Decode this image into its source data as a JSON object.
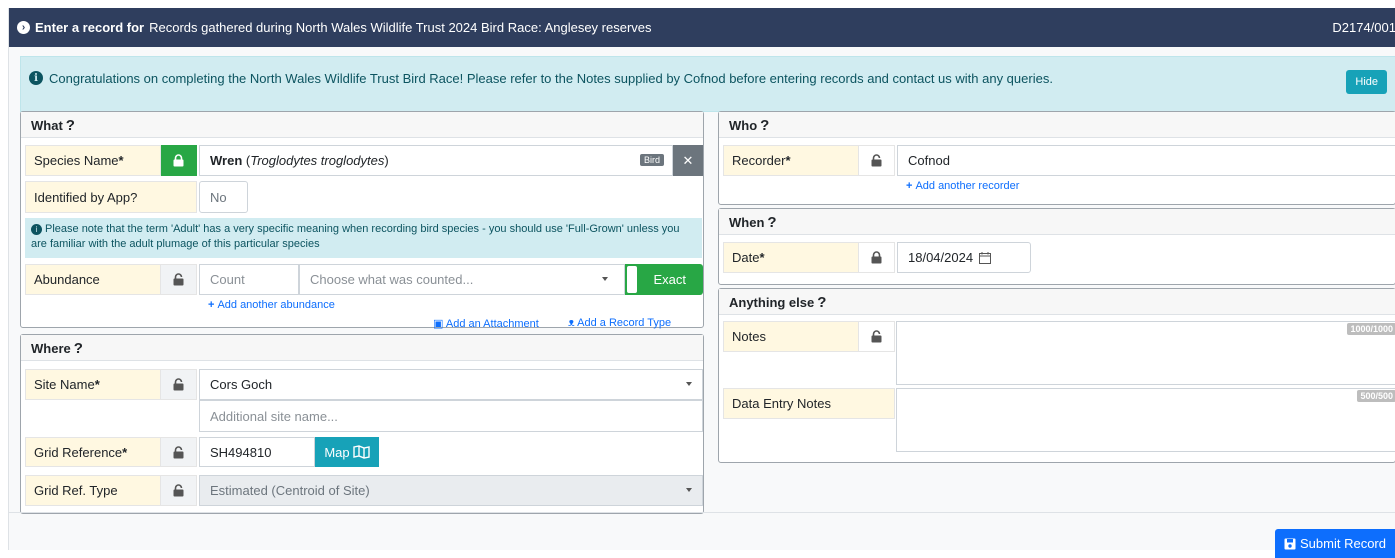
{
  "header": {
    "prefix": "Enter a record for",
    "title": "Records gathered during North Wales Wildlife Trust 2024 Bird Race: Anglesey reserves",
    "reference": "D2174/001"
  },
  "alert": {
    "message": "Congratulations on completing the North Wales Wildlife Trust Bird Race! Please refer to the Notes supplied by Cofnod before entering records and contact us with any queries.",
    "hide_label": "Hide"
  },
  "what": {
    "title": "What",
    "species_label": "Species Name",
    "species_common": "Wren",
    "species_latin": "Troglodytes troglodytes",
    "species_group": "Bird",
    "clear_symbol": "✕",
    "identified_label": "Identified by App?",
    "identified_value": "No",
    "note": "Please note that the term 'Adult' has a very specific meaning when recording bird species - you should use 'Full-Grown' unless you are familiar with the adult plumage of this particular species",
    "abundance_label": "Abundance",
    "count_placeholder": "Count",
    "counted_placeholder": "Choose what was counted...",
    "exact_label": "Exact",
    "add_abundance": "Add another abundance",
    "add_attachment": "Add an Attachment",
    "add_record_type": "Add a Record Type"
  },
  "where": {
    "title": "Where",
    "site_label": "Site Name",
    "site_value": "Cors Goch",
    "additional_placeholder": "Additional site name...",
    "grid_label": "Grid Reference",
    "grid_value": "SH494810",
    "map_label": "Map",
    "gridtype_label": "Grid Ref. Type",
    "gridtype_value": "Estimated (Centroid of Site)"
  },
  "who": {
    "title": "Who",
    "recorder_label": "Recorder",
    "recorder_value": "Cofnod",
    "add_recorder": "Add another recorder"
  },
  "when": {
    "title": "When",
    "date_label": "Date",
    "date_value": "18/04/2024"
  },
  "else": {
    "title": "Anything else",
    "notes_label": "Notes",
    "notes_count": "1000/1000",
    "den_label": "Data Entry Notes",
    "den_count": "500/500"
  },
  "footer": {
    "submit_label": "Submit Record"
  },
  "colors": {
    "header": "#2f3e5e",
    "label_bg": "#fff8e1",
    "success": "#28a745",
    "info": "#17a2b8",
    "primary": "#0d6efd"
  }
}
